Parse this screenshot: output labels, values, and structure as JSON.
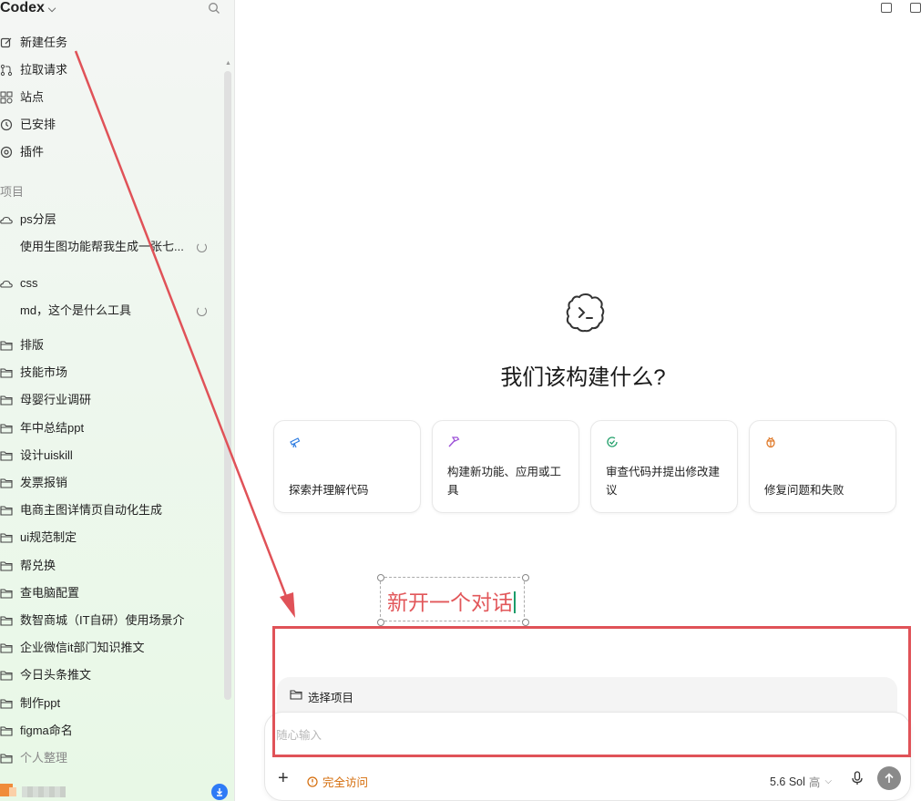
{
  "app": {
    "title": "Codex"
  },
  "nav": [
    {
      "label": "新建任务",
      "icon": "edit-icon"
    },
    {
      "label": "拉取请求",
      "icon": "pull-request-icon"
    },
    {
      "label": "站点",
      "icon": "sites-icon"
    },
    {
      "label": "已安排",
      "icon": "clock-icon"
    },
    {
      "label": "插件",
      "icon": "plugin-icon"
    }
  ],
  "projects_label": "项目",
  "projects": [
    {
      "name": "ps分层",
      "tasks": [
        "使用生图功能帮我生成一张七..."
      ]
    },
    {
      "name": "css",
      "tasks": [
        "md，这个是什么工具"
      ]
    }
  ],
  "folders": [
    "排版",
    "技能市场",
    "母婴行业调研",
    "年中总结ppt",
    "设计uiskill",
    "发票报销",
    "电商主图详情页自动化生成",
    "ui规范制定",
    "帮兑换",
    "查电脑配置",
    "数智商城（IT自研）使用场景介",
    "企业微信it部门知识推文",
    "今日头条推文",
    "制作ppt",
    "figma命名",
    "个人整理"
  ],
  "main": {
    "title": "我们该构建什么?",
    "cards": [
      {
        "label": "探索并理解代码",
        "icon": "telescope-icon",
        "color": "#2f7de1"
      },
      {
        "label": "构建新功能、应用或工具",
        "icon": "hammer-icon",
        "color": "#9b4fd6"
      },
      {
        "label": "审查代码并提出修改建议",
        "icon": "review-icon",
        "color": "#23a06b"
      },
      {
        "label": "修复问题和失败",
        "icon": "bug-icon",
        "color": "#e07a2a"
      }
    ]
  },
  "annotation": {
    "text": "新开一个对话",
    "color": "#e2575a",
    "box_color": "#e05258"
  },
  "composer": {
    "project_select": "选择项目",
    "placeholder": "随心输入",
    "access_label": "完全访问",
    "model": "5.6 Sol",
    "level": "高"
  },
  "colors": {
    "accent_orange": "#d46b08",
    "download_blue": "#2e7bf6"
  }
}
